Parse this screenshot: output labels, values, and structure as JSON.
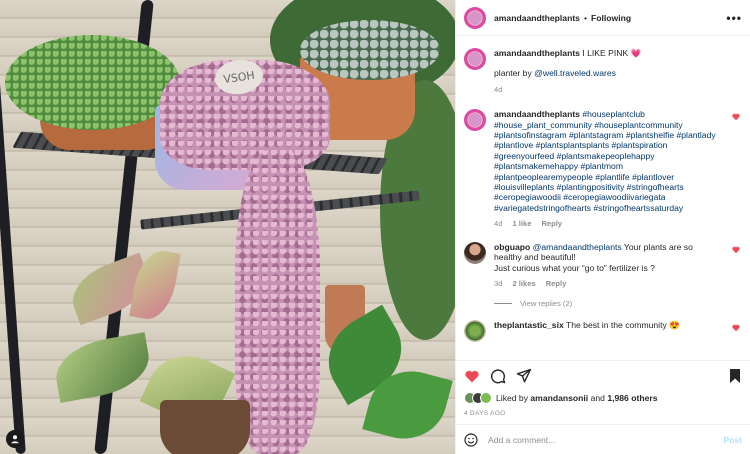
{
  "photo": {
    "tag_text": "VSOH"
  },
  "header": {
    "username": "amandaandtheplants",
    "separator": "•",
    "follow_label": "Following",
    "more": "•••"
  },
  "caption": {
    "username": "amandaandtheplants",
    "text": "I LIKE PINK 💗",
    "line2_prefix": "planter by ",
    "line2_mention": "@well.traveled.wares",
    "time": "4d"
  },
  "hashtag_comment": {
    "username": "amandaandtheplants",
    "text": "#houseplantclub #house_plant_community #houseplantcommunity #plantsofinstagram #plantstagram #plantshelfie #plantlady #plantlove #plantsplantsplants #plantspiration #greenyourfeed #plantsmakepeoplehappy #plantsmakemehappy #plantmom #plantpeoplearemypeople #plantlife #plantlover #louisvilleplants #plantingpositivity #stringofhearts #ceropegiawoodii #ceropegiawoodiivariegata #variegatedstringofhearts #stringofheartssaturday",
    "time": "4d",
    "likes": "1 like",
    "reply": "Reply"
  },
  "obguapo_comment": {
    "username": "obguapo",
    "mention": "@amandaandtheplants",
    "text1": " Your plants are so healthy and beautiful!",
    "text2": "Just curious what your “go to” fertilizer is ?",
    "time": "3d",
    "likes": "2 likes",
    "reply": "Reply",
    "view_replies": "View replies (2)"
  },
  "plantastic_comment": {
    "username": "theplantastic_six",
    "text": "The best in the community 😍"
  },
  "likes": {
    "prefix": "Liked by ",
    "user": "amandansonii",
    "middle": " and ",
    "others": "1,986 others"
  },
  "time_ago": "4 DAYS AGO",
  "add_comment": {
    "placeholder": "Add a comment...",
    "post_label": "Post"
  },
  "colors": {
    "like_red": "#ed4956",
    "link_blue": "#00376b",
    "muted": "#8e8e8e"
  }
}
